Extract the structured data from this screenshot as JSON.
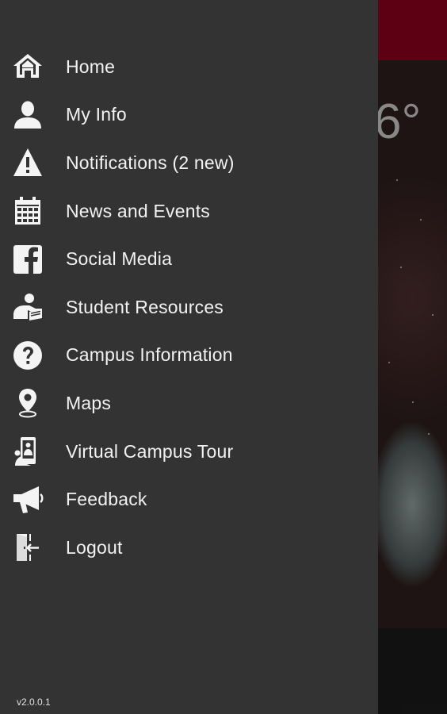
{
  "background": {
    "temperature_fragment": "6°",
    "header_color": "#6b0016"
  },
  "drawer": {
    "background_color": "#333333",
    "items": [
      {
        "label": "Home",
        "icon": "home-icon"
      },
      {
        "label": "My Info",
        "icon": "person-icon"
      },
      {
        "label": "Notifications (2 new)",
        "icon": "warning-icon"
      },
      {
        "label": "News and Events",
        "icon": "calendar-icon"
      },
      {
        "label": "Social Media",
        "icon": "facebook-icon"
      },
      {
        "label": "Student Resources",
        "icon": "student-reading-icon"
      },
      {
        "label": "Campus Information",
        "icon": "question-icon"
      },
      {
        "label": "Maps",
        "icon": "map-pin-icon"
      },
      {
        "label": "Virtual Campus Tour",
        "icon": "phone-tour-icon"
      },
      {
        "label": "Feedback",
        "icon": "megaphone-icon"
      },
      {
        "label": "Logout",
        "icon": "logout-door-icon"
      }
    ],
    "version": "v2.0.0.1"
  }
}
